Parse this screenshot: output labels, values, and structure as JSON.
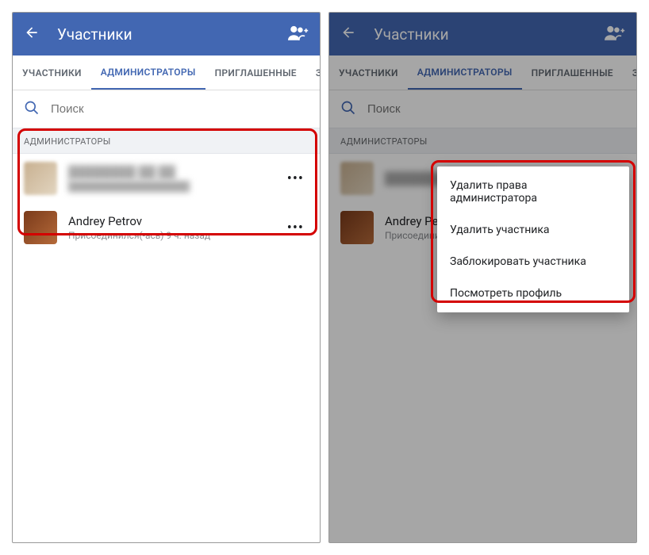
{
  "header": {
    "title": "Участники"
  },
  "tabs": [
    "УЧАСТНИКИ",
    "АДМИНИСТРАТОРЫ",
    "ПРИГЛАШЕННЫЕ",
    "ЗАБЛОКИ"
  ],
  "active_tab_index": 1,
  "search": {
    "placeholder": "Поиск"
  },
  "section": {
    "label": "АДМИНИСТРАТОРЫ"
  },
  "admins": [
    {
      "name": "████████ ██ ██",
      "sub": "██████████████████",
      "blurred": true
    },
    {
      "name": "Andrey Petrov",
      "sub": "Присоединился(-ась) 9 ч. назад",
      "blurred": false
    }
  ],
  "right_panel": {
    "admin1_name": "████████ ██ ██",
    "admin2_name": "Andrey Petrov",
    "admin2_sub_truncated": "Присоединился(-ас"
  },
  "popup": {
    "items": [
      "Удалить права администратора",
      "Удалить участника",
      "Заблокировать участника",
      "Посмотреть профиль"
    ]
  }
}
